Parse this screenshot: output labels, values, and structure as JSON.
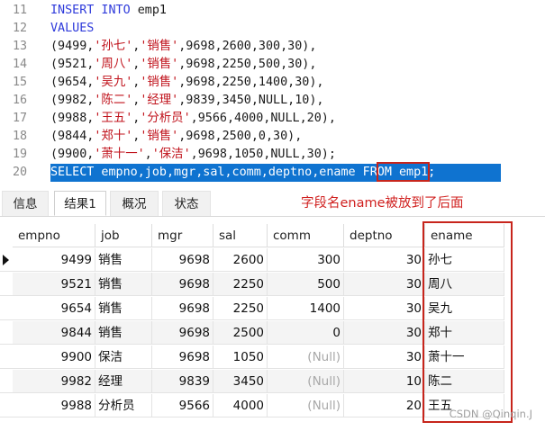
{
  "editor": {
    "lines": [
      {
        "no": "11",
        "tokens": [
          {
            "t": "INSERT INTO ",
            "c": "kw"
          },
          {
            "t": "emp1",
            "c": "pun"
          }
        ]
      },
      {
        "no": "12",
        "tokens": [
          {
            "t": "VALUES",
            "c": "kw"
          }
        ]
      },
      {
        "no": "13",
        "tokens": [
          {
            "t": "(9499,",
            "c": "num"
          },
          {
            "t": "'孙七'",
            "c": "str"
          },
          {
            "t": ",",
            "c": "pun"
          },
          {
            "t": "'销售'",
            "c": "str"
          },
          {
            "t": ",9698,2600,300,30),",
            "c": "num"
          }
        ]
      },
      {
        "no": "14",
        "tokens": [
          {
            "t": "(9521,",
            "c": "num"
          },
          {
            "t": "'周八'",
            "c": "str"
          },
          {
            "t": ",",
            "c": "pun"
          },
          {
            "t": "'销售'",
            "c": "str"
          },
          {
            "t": ",9698,2250,500,30),",
            "c": "num"
          }
        ]
      },
      {
        "no": "15",
        "tokens": [
          {
            "t": "(9654,",
            "c": "num"
          },
          {
            "t": "'吴九'",
            "c": "str"
          },
          {
            "t": ",",
            "c": "pun"
          },
          {
            "t": "'销售'",
            "c": "str"
          },
          {
            "t": ",9698,2250,1400,30),",
            "c": "num"
          }
        ]
      },
      {
        "no": "16",
        "tokens": [
          {
            "t": "(9982,",
            "c": "num"
          },
          {
            "t": "'陈二'",
            "c": "str"
          },
          {
            "t": ",",
            "c": "pun"
          },
          {
            "t": "'经理'",
            "c": "str"
          },
          {
            "t": ",9839,3450,NULL,10),",
            "c": "num"
          }
        ]
      },
      {
        "no": "17",
        "tokens": [
          {
            "t": "(9988,",
            "c": "num"
          },
          {
            "t": "'王五'",
            "c": "str"
          },
          {
            "t": ",",
            "c": "pun"
          },
          {
            "t": "'分析员'",
            "c": "str"
          },
          {
            "t": ",9566,4000,NULL,20),",
            "c": "num"
          }
        ]
      },
      {
        "no": "18",
        "tokens": [
          {
            "t": "(9844,",
            "c": "num"
          },
          {
            "t": "'郑十'",
            "c": "str"
          },
          {
            "t": ",",
            "c": "pun"
          },
          {
            "t": "'销售'",
            "c": "str"
          },
          {
            "t": ",9698,2500,0,30),",
            "c": "num"
          }
        ]
      },
      {
        "no": "19",
        "tokens": [
          {
            "t": "(9900,",
            "c": "num"
          },
          {
            "t": "'萧十一'",
            "c": "str"
          },
          {
            "t": ",",
            "c": "pun"
          },
          {
            "t": "'保洁'",
            "c": "str"
          },
          {
            "t": ",9698,1050,NULL,30);",
            "c": "num"
          }
        ]
      },
      {
        "no": "20",
        "selected": true,
        "tokens": [
          {
            "t": "SELECT empno,job,mgr,sal,comm,deptno,ename FROM emp1;",
            "c": "sel-text"
          }
        ]
      }
    ]
  },
  "tabs": [
    {
      "label": "信息",
      "active": false
    },
    {
      "label": "结果1",
      "active": true
    },
    {
      "label": "概况",
      "active": false
    },
    {
      "label": "状态",
      "active": false
    }
  ],
  "annotation": "字段名ename被放到了后面",
  "table": {
    "columns": [
      "empno",
      "job",
      "mgr",
      "sal",
      "comm",
      "deptno",
      "ename"
    ],
    "rows": [
      [
        "9499",
        "销售",
        "9698",
        "2600",
        "300",
        "30",
        "孙七"
      ],
      [
        "9521",
        "销售",
        "9698",
        "2250",
        "500",
        "30",
        "周八"
      ],
      [
        "9654",
        "销售",
        "9698",
        "2250",
        "1400",
        "30",
        "吴九"
      ],
      [
        "9844",
        "销售",
        "9698",
        "2500",
        "0",
        "30",
        "郑十"
      ],
      [
        "9900",
        "保洁",
        "9698",
        "1050",
        "(Null)",
        "30",
        "萧十一"
      ],
      [
        "9982",
        "经理",
        "9839",
        "3450",
        "(Null)",
        "10",
        "陈二"
      ],
      [
        "9988",
        "分析员",
        "9566",
        "4000",
        "(Null)",
        "20",
        "王五"
      ]
    ]
  },
  "watermark": "CSDN @Qinqin.J",
  "colors": {
    "keyword": "#2f3bdb",
    "string": "#c0121b",
    "selection": "#0f73d0",
    "highlight": "#c7251c"
  }
}
